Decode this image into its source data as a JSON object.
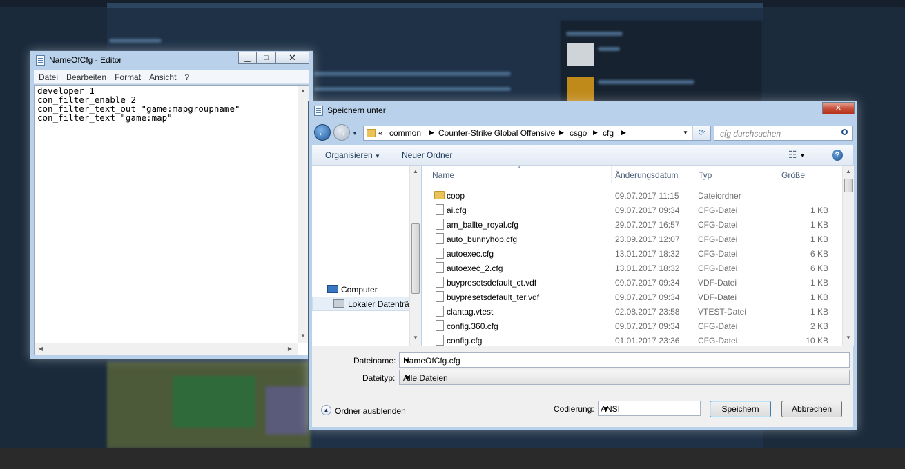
{
  "notepad": {
    "title": "NameOfCfg - Editor",
    "menu": [
      "Datei",
      "Bearbeiten",
      "Format",
      "Ansicht",
      "?"
    ],
    "content_lines": [
      "developer 1",
      "con_filter_enable 2",
      "con_filter_text_out \"game:mapgroupname\"",
      "con_filter_text \"game:map\""
    ]
  },
  "save_dialog": {
    "title": "Speichern unter",
    "breadcrumb": {
      "overflow": "«",
      "items": [
        "common",
        "Counter-Strike Global Offensive",
        "csgo",
        "cfg"
      ]
    },
    "search_placeholder": "cfg durchsuchen",
    "toolbar": {
      "organize": "Organisieren",
      "new_folder": "Neuer Ordner"
    },
    "nav": {
      "computer": "Computer",
      "local_disk": "Lokaler Datenträg"
    },
    "columns": {
      "name": "Name",
      "date": "Änderungsdatum",
      "type": "Typ",
      "size": "Größe"
    },
    "files": [
      {
        "name": "coop",
        "date": "09.07.2017 11:15",
        "type": "Dateiordner",
        "size": "",
        "kind": "folder"
      },
      {
        "name": "ai.cfg",
        "date": "09.07.2017 09:34",
        "type": "CFG-Datei",
        "size": "1 KB",
        "kind": "file"
      },
      {
        "name": "am_ballte_royal.cfg",
        "date": "29.07.2017 16:57",
        "type": "CFG-Datei",
        "size": "1 KB",
        "kind": "file"
      },
      {
        "name": "auto_bunnyhop.cfg",
        "date": "23.09.2017 12:07",
        "type": "CFG-Datei",
        "size": "1 KB",
        "kind": "file"
      },
      {
        "name": "autoexec.cfg",
        "date": "13.01.2017 18:32",
        "type": "CFG-Datei",
        "size": "6 KB",
        "kind": "file"
      },
      {
        "name": "autoexec_2.cfg",
        "date": "13.01.2017 18:32",
        "type": "CFG-Datei",
        "size": "6 KB",
        "kind": "file"
      },
      {
        "name": "buypresetsdefault_ct.vdf",
        "date": "09.07.2017 09:34",
        "type": "VDF-Datei",
        "size": "1 KB",
        "kind": "file"
      },
      {
        "name": "buypresetsdefault_ter.vdf",
        "date": "09.07.2017 09:34",
        "type": "VDF-Datei",
        "size": "1 KB",
        "kind": "file"
      },
      {
        "name": "clantag.vtest",
        "date": "02.08.2017 23:58",
        "type": "VTEST-Datei",
        "size": "1 KB",
        "kind": "file"
      },
      {
        "name": "config.360.cfg",
        "date": "09.07.2017 09:34",
        "type": "CFG-Datei",
        "size": "2 KB",
        "kind": "file"
      },
      {
        "name": "config.cfg",
        "date": "01.01.2017 23:36",
        "type": "CFG-Datei",
        "size": "10 KB",
        "kind": "file"
      }
    ],
    "filename_label": "Dateiname:",
    "filename_value": "NameOfCfg.cfg",
    "filetype_label": "Dateityp:",
    "filetype_value": "Alle Dateien",
    "hide_folders": "Ordner ausblenden",
    "encoding_label": "Codierung:",
    "encoding_value": "ANSI",
    "save_button": "Speichern",
    "cancel_button": "Abbrechen"
  }
}
